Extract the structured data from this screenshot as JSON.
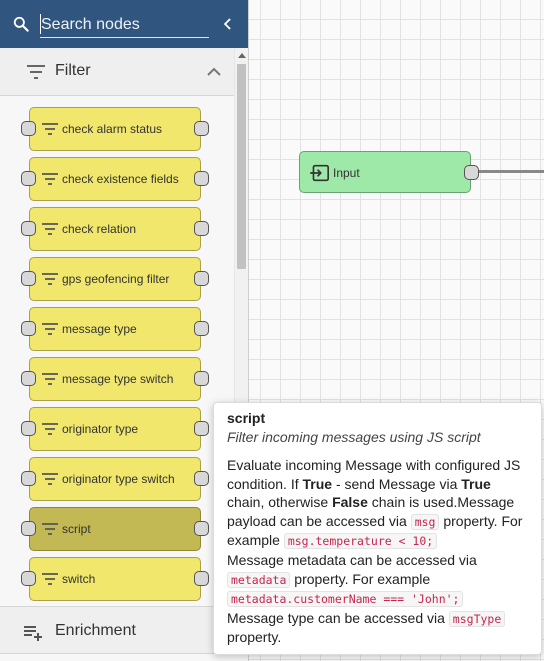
{
  "search": {
    "placeholder": "Search nodes"
  },
  "sections": {
    "filter": {
      "title": "Filter"
    },
    "enrichment": {
      "title": "Enrichment"
    }
  },
  "filter_nodes": [
    {
      "label": "check alarm status"
    },
    {
      "label": "check existence fields"
    },
    {
      "label": "check relation"
    },
    {
      "label": "gps geofencing filter"
    },
    {
      "label": "message type"
    },
    {
      "label": "message type switch"
    },
    {
      "label": "originator type"
    },
    {
      "label": "originator type switch"
    },
    {
      "label": "script"
    },
    {
      "label": "switch"
    }
  ],
  "canvas": {
    "input_node": {
      "label": "Input"
    }
  },
  "tooltip": {
    "title": "script",
    "subtitle": "Filter incoming messages using JS script",
    "t1": "Evaluate incoming Message with configured JS condition. If ",
    "b1": "True",
    "t2": " - send Message via ",
    "b2": "True",
    "t3": " chain, otherwise ",
    "b3": "False",
    "t4": " chain is used.Message payload can be accessed via ",
    "c1": "msg",
    "t5": " property. For example ",
    "c2": "msg.temperature < 10;",
    "t6": "Message metadata can be accessed via ",
    "c3": "metadata",
    "t7": " property. For example ",
    "c4": "metadata.customerName === 'John';",
    "t8": "Message type can be accessed via ",
    "c5": "msgType",
    "t9": " property."
  },
  "colors": {
    "header": "#305680",
    "filter_node": "#f0e76c",
    "filter_node_selected": "#c2b955",
    "input_node": "#9ee8a8"
  },
  "icons": {
    "search": "search-icon",
    "collapse": "chevron-left-icon",
    "filter": "filter-list-icon",
    "enrichment": "playlist-add-icon",
    "input": "input-icon"
  }
}
